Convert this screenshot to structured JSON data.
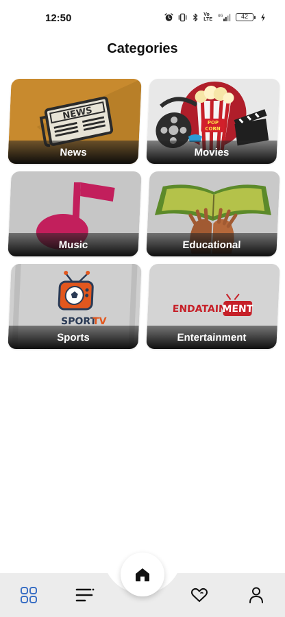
{
  "status_bar": {
    "time": "12:50",
    "network_label_top": "Vo",
    "network_label_bottom": "LTE",
    "battery_level": "42",
    "icons": [
      "alarm-icon",
      "vibrate-icon",
      "bluetooth-icon",
      "volte-icon",
      "signal-icon",
      "battery-icon",
      "charging-icon"
    ]
  },
  "page": {
    "title": "Categories"
  },
  "categories": [
    {
      "label": "News",
      "art": "newspaper-icon",
      "bg": "#c88a2e"
    },
    {
      "label": "Movies",
      "art": "popcorn-film-icon",
      "bg": "#e8e8e8"
    },
    {
      "label": "Music",
      "art": "music-note-icon",
      "bg": "#c6c6c6"
    },
    {
      "label": "Educational",
      "art": "open-book-hands-icon",
      "bg": "#c9c9c9"
    },
    {
      "label": "Sports",
      "art": "sport-tv-logo",
      "bg": "#cfcfcf"
    },
    {
      "label": "Entertainment",
      "art": "entertainment-logo",
      "bg": "#d4d4d4"
    }
  ],
  "art_text": {
    "news": "NEWS",
    "popcorn_top": "POP",
    "popcorn_bottom": "CORN",
    "sport": "SPORT",
    "tv": "TV",
    "ent_a": "ENDATAIN",
    "ent_b": "MENT"
  },
  "bottom_nav": {
    "items": [
      "categories-icon",
      "menu-icon",
      "home-icon",
      "favorites-icon",
      "profile-icon"
    ],
    "active": "categories-icon",
    "active_color": "#3a6fc4"
  }
}
